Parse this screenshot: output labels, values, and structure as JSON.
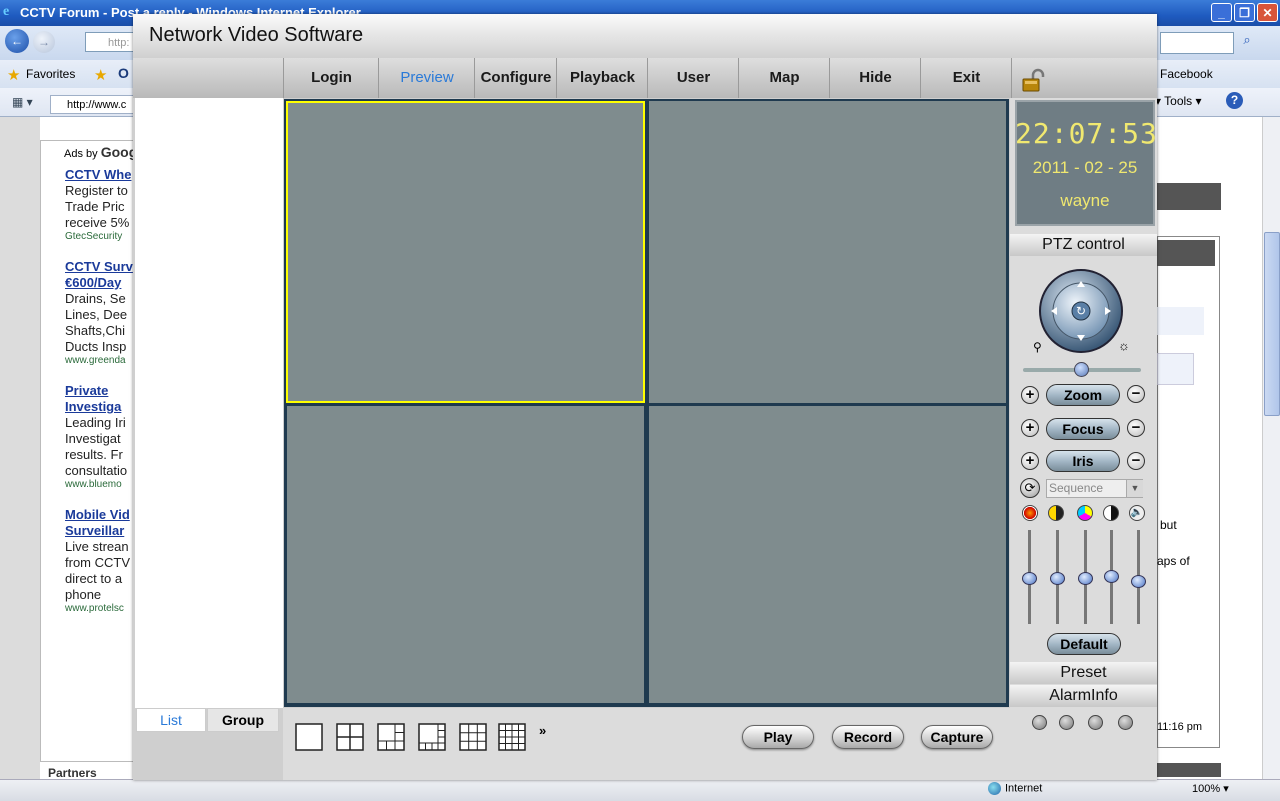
{
  "browser": {
    "window_title": "CCTV Forum - Post a reply - Windows Internet Explorer",
    "address_partial": "http:",
    "tab_url": "http://www.c",
    "favorites_label": "Favorites",
    "favorites_item": "O",
    "facebook_label": "Facebook",
    "tools_label": "Tools",
    "status_internet": "Internet",
    "status_zoom": "100%"
  },
  "webpage": {
    "ads_by": "Ads by",
    "ads_by_brand": "Goog",
    "ads": [
      {
        "title_lines": [
          "CCTV Whe"
        ],
        "body_lines": [
          "Register to",
          "Trade Pric",
          "receive 5%"
        ],
        "url": "GtecSecurity"
      },
      {
        "title_lines": [
          "CCTV Surv",
          "€600/Day"
        ],
        "body_lines": [
          "Drains, Se",
          "Lines, Dee",
          "Shafts,Chi",
          "Ducts Insp"
        ],
        "url": "www.greenda"
      },
      {
        "title_lines": [
          "Private",
          "Investiga"
        ],
        "body_lines": [
          "Leading Iri",
          "Investigat",
          "results. Fr",
          "consultatio"
        ],
        "url": "www.bluemo"
      },
      {
        "title_lines": [
          "Mobile Vid",
          "Surveillar"
        ],
        "body_lines": [
          "Live strean",
          "from CCTV",
          "direct to a",
          "phone"
        ],
        "url": "www.protelsc"
      }
    ],
    "partners_label": "Partners",
    "right_text_but": "but",
    "right_text_aps": "aps of",
    "right_text_time": "11:16 pm"
  },
  "app": {
    "title": "Network Video Software",
    "menu": [
      {
        "label": "Login",
        "active": false
      },
      {
        "label": "Preview",
        "active": true
      },
      {
        "label": "Configure",
        "active": false
      },
      {
        "label": "Playback",
        "active": false
      },
      {
        "label": "User",
        "active": false
      },
      {
        "label": "Map",
        "active": false
      },
      {
        "label": "Hide",
        "active": false
      },
      {
        "label": "Exit",
        "active": false
      }
    ],
    "left_tabs": {
      "list": "List",
      "group": "Group"
    },
    "layout_more": "»",
    "buttons": {
      "play": "Play",
      "record": "Record",
      "capture": "Capture"
    },
    "clock": {
      "time": "22:07:53",
      "date": "2011 - 02 - 25",
      "user": "wayne"
    },
    "ptz": {
      "title": "PTZ control",
      "zoom": "Zoom",
      "focus": "Focus",
      "iris": "Iris",
      "sequence_placeholder": "Sequence",
      "default": "Default",
      "preset": "Preset",
      "alarm_info": "AlarmInfo",
      "image_levels": [
        0.5,
        0.5,
        0.5,
        0.52,
        0.46
      ]
    },
    "colors": {
      "accent": "#2a7ad8",
      "clock_text": "#f0e870",
      "selected_cell": "#ffff00",
      "video_cell": "#7f8c8e"
    }
  }
}
